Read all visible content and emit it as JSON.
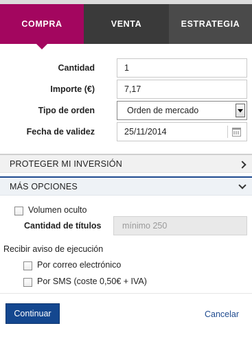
{
  "tabs": [
    {
      "label": "COMPRA",
      "active": true
    },
    {
      "label": "VENTA",
      "active": false
    },
    {
      "label": "ESTRATEGIA",
      "active": false
    }
  ],
  "form": {
    "cantidad": {
      "label": "Cantidad",
      "value": "1"
    },
    "importe": {
      "label": "Importe (€)",
      "value": "7,17"
    },
    "tipo_orden": {
      "label": "Tipo de orden",
      "selected": "Orden de mercado"
    },
    "fecha_validez": {
      "label": "Fecha de validez",
      "value": "25/11/2014"
    }
  },
  "sections": {
    "proteger": {
      "label": "PROTEGER MI INVERSIÓN",
      "expanded": false
    },
    "mas_opciones": {
      "label": "MÁS OPCIONES",
      "expanded": true
    }
  },
  "options": {
    "volumen_oculto": {
      "label": "Volumen oculto",
      "checked": false
    },
    "cantidad_titulos": {
      "label": "Cantidad de títulos",
      "placeholder": "mínimo 250"
    },
    "aviso_label": "Recibir aviso de ejecución",
    "correo": {
      "label": "Por correo electrónico",
      "checked": false
    },
    "sms": {
      "label": "Por SMS (coste 0,50€ + IVA)",
      "checked": false
    }
  },
  "actions": {
    "continuar": "Continuar",
    "cancelar": "Cancelar"
  },
  "colors": {
    "active_tab": "#a3065f",
    "dark_tab": "#3a3a3a",
    "primary_button": "#14478f",
    "link": "#1e4a8f"
  },
  "icons": {
    "select_arrow": "triangle-down",
    "date_picker": "calendar-icon",
    "section_collapsed": "chevron-right-icon",
    "section_expanded": "chevron-down-icon"
  }
}
